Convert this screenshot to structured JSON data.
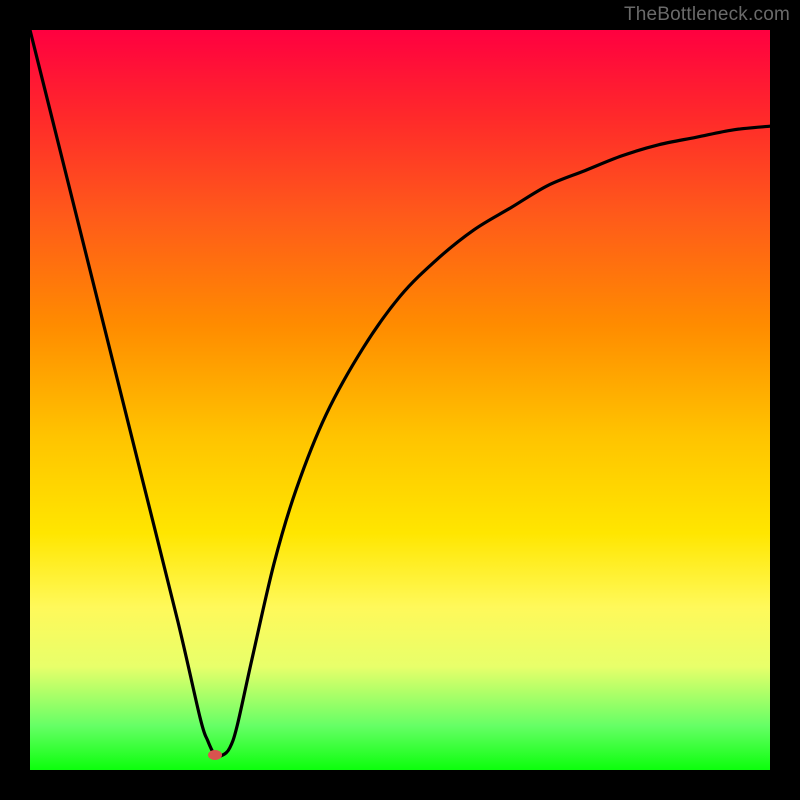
{
  "attribution": "TheBottleneck.com",
  "colors": {
    "frame": "#000000",
    "gradient_top": "#ff0040",
    "gradient_bottom": "#0cff0c",
    "curve": "#000000",
    "marker": "#d9534f",
    "attribution_text": "#6a6a6a"
  },
  "chart_data": {
    "type": "line",
    "title": "",
    "xlabel": "",
    "ylabel": "",
    "xlim": [
      0,
      100
    ],
    "ylim": [
      0,
      100
    ],
    "grid": false,
    "legend": false,
    "annotations": [
      "TheBottleneck.com"
    ],
    "series": [
      {
        "name": "bottleneck-curve",
        "x": [
          0,
          5,
          10,
          15,
          20,
          23,
          24,
          25,
          26,
          27,
          28,
          30,
          33,
          36,
          40,
          45,
          50,
          55,
          60,
          65,
          70,
          75,
          80,
          85,
          90,
          95,
          100
        ],
        "values": [
          100,
          80,
          60,
          40,
          20,
          7,
          4,
          2,
          2,
          3,
          6,
          15,
          28,
          38,
          48,
          57,
          64,
          69,
          73,
          76,
          79,
          81,
          83,
          84.5,
          85.5,
          86.5,
          87
        ]
      }
    ],
    "marker": {
      "x": 25,
      "y": 2
    },
    "background": "vertical-gradient red→orange→yellow→green"
  }
}
